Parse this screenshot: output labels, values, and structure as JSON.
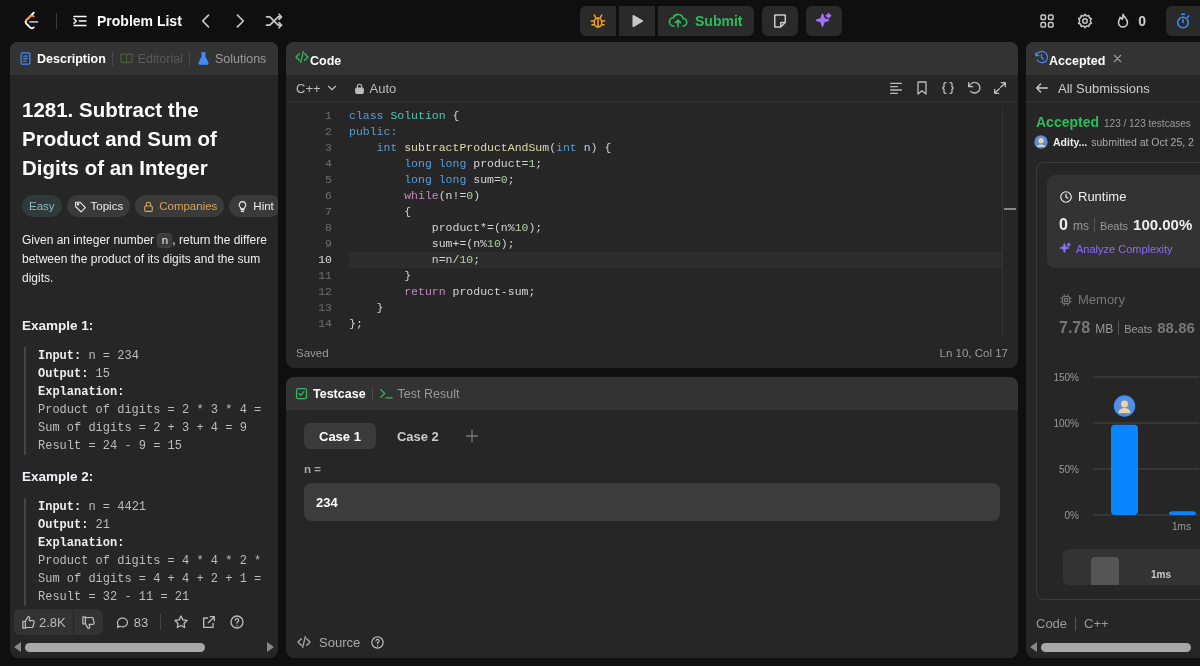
{
  "topbar": {
    "problem_list": "Problem List",
    "submit": "Submit",
    "streak": "0"
  },
  "description_panel": {
    "tabs": [
      {
        "label": "Description",
        "kind": "description",
        "selected": true,
        "disabled": false
      },
      {
        "label": "Editorial",
        "kind": "editorial",
        "selected": false,
        "disabled": true
      },
      {
        "label": "Solutions",
        "kind": "solutions",
        "selected": false,
        "disabled": false
      }
    ],
    "title": "1281. Subtract the Product and Sum of Digits of an Integer",
    "tags": [
      {
        "kind": "difficulty",
        "label": "Easy"
      },
      {
        "kind": "topics",
        "label": "Topics"
      },
      {
        "kind": "premium",
        "label": "Companies"
      },
      {
        "kind": "hint",
        "label": "Hint"
      }
    ],
    "description": [
      [
        {
          "text": "Given an integer number "
        },
        {
          "code": "n"
        },
        {
          "text": ", return the differe"
        }
      ],
      [
        {
          "text": "between the product of its digits and the sum"
        }
      ],
      [
        {
          "text": "digits."
        }
      ]
    ],
    "examples": [
      {
        "heading": "Example 1:",
        "lines": [
          {
            "label": "Input:",
            "value": "n = 234"
          },
          {
            "label": "Output:",
            "value": "15"
          },
          {
            "label": "Explanation:"
          },
          {
            "value": "Product of digits = 2 * 3 * 4 ="
          },
          {
            "value": "Sum of digits = 2 + 3 + 4 = 9"
          },
          {
            "value": "Result = 24 - 9 = 15"
          }
        ]
      },
      {
        "heading": "Example 2:",
        "lines": [
          {
            "label": "Input:",
            "value": "n = 4421"
          },
          {
            "label": "Output:",
            "value": "21"
          },
          {
            "label": "Explanation:"
          },
          {
            "value": "Product of digits = 4 * 4 * 2 *"
          },
          {
            "value": "Sum of digits = 4 + 4 + 2 + 1 ="
          },
          {
            "value": "Result = 32 - 11 = 21"
          }
        ]
      }
    ],
    "footer": {
      "likes": "2.8K",
      "comments": "83"
    }
  },
  "code_panel": {
    "title": "Code",
    "language": "C++",
    "mode": "Auto",
    "lines": [
      {
        "number": "1",
        "current": false,
        "tokens": [
          {
            "kind": "keyword",
            "text": "class"
          },
          {
            "kind": "type",
            "text": " Solution"
          },
          {
            "kind": "plain",
            "text": " {"
          }
        ]
      },
      {
        "number": "2",
        "current": false,
        "tokens": [
          {
            "kind": "keyword",
            "text": "public:"
          }
        ]
      },
      {
        "number": "3",
        "current": false,
        "tokens": [
          {
            "kind": "keyword",
            "text": "    int"
          },
          {
            "kind": "function",
            "text": " subtractProductAndSum"
          },
          {
            "kind": "plain",
            "text": "("
          },
          {
            "kind": "keyword",
            "text": "int"
          },
          {
            "kind": "variable",
            "text": " n"
          },
          {
            "kind": "plain",
            "text": ") {"
          }
        ]
      },
      {
        "number": "4",
        "current": false,
        "tokens": [
          {
            "kind": "keyword",
            "text": "        long long"
          },
          {
            "kind": "plain",
            "text": " product="
          },
          {
            "kind": "number",
            "text": "1"
          },
          {
            "kind": "plain",
            "text": ";"
          }
        ]
      },
      {
        "number": "5",
        "current": false,
        "tokens": [
          {
            "kind": "keyword",
            "text": "        long long"
          },
          {
            "kind": "plain",
            "text": " sum="
          },
          {
            "kind": "number",
            "text": "0"
          },
          {
            "kind": "plain",
            "text": ";"
          }
        ]
      },
      {
        "number": "6",
        "current": false,
        "tokens": [
          {
            "kind": "control",
            "text": "        while"
          },
          {
            "kind": "plain",
            "text": "(n!="
          },
          {
            "kind": "number",
            "text": "0"
          },
          {
            "kind": "plain",
            "text": ")"
          }
        ]
      },
      {
        "number": "7",
        "current": false,
        "tokens": [
          {
            "kind": "plain",
            "text": "        {"
          }
        ]
      },
      {
        "number": "8",
        "current": false,
        "tokens": [
          {
            "kind": "plain",
            "text": "            product*=(n%"
          },
          {
            "kind": "number",
            "text": "10"
          },
          {
            "kind": "plain",
            "text": ");"
          }
        ]
      },
      {
        "number": "9",
        "current": false,
        "tokens": [
          {
            "kind": "plain",
            "text": "            sum+=(n%"
          },
          {
            "kind": "number",
            "text": "10"
          },
          {
            "kind": "plain",
            "text": ");"
          }
        ]
      },
      {
        "number": "10",
        "current": true,
        "tokens": [
          {
            "kind": "plain",
            "text": "            n=n/"
          },
          {
            "kind": "number",
            "text": "10"
          },
          {
            "kind": "plain",
            "text": ";"
          }
        ]
      },
      {
        "number": "11",
        "current": false,
        "tokens": [
          {
            "kind": "plain",
            "text": "        }"
          }
        ]
      },
      {
        "number": "12",
        "current": false,
        "tokens": [
          {
            "kind": "control",
            "text": "        return"
          },
          {
            "kind": "plain",
            "text": " product-sum;"
          }
        ]
      },
      {
        "number": "13",
        "current": false,
        "tokens": [
          {
            "kind": "plain",
            "text": "    }"
          }
        ]
      },
      {
        "number": "14",
        "current": false,
        "tokens": [
          {
            "kind": "plain",
            "text": "};"
          }
        ]
      }
    ],
    "status": "Saved",
    "cursor": "Ln 10, Col 17"
  },
  "testcase_panel": {
    "tabs": [
      {
        "label": "Testcase",
        "kind": "testcase",
        "selected": true
      },
      {
        "label": "Test Result",
        "kind": "result",
        "selected": false
      }
    ],
    "cases": [
      {
        "label": "Case 1",
        "selected": true
      },
      {
        "label": "Case 2",
        "selected": false
      }
    ],
    "param": "n =",
    "value": "234",
    "source": "Source"
  },
  "submission_panel": {
    "tab": "Accepted",
    "back": "All Submissions",
    "verdict": "Accepted",
    "testcases": "123 / 123 testcases",
    "user": "Adity...",
    "submitted": "submitted at Oct 25, 2",
    "metrics": [
      {
        "kind": "runtime",
        "selected": true,
        "label": "Runtime",
        "value": "0",
        "unit": "ms",
        "beats_label": "Beats",
        "beats": "100.00%",
        "action": "Analyze Complexity"
      },
      {
        "kind": "memory",
        "selected": false,
        "label": "Memory",
        "value": "7.78",
        "unit": "MB",
        "beats_label": "Beats",
        "beats": "88.86"
      }
    ],
    "chart_data": {
      "type": "bar",
      "categories": [
        null,
        "1ms"
      ],
      "values": [
        98,
        4
      ],
      "ylim": [
        0,
        150
      ],
      "yticks": [
        {
          "value": 0,
          "label": "0%"
        },
        {
          "value": 50,
          "label": "50%"
        },
        {
          "value": 100,
          "label": "100%"
        },
        {
          "value": 150,
          "label": "150%"
        }
      ]
    },
    "navigator_label": "1ms",
    "code_label": "Code",
    "code_language": "C++"
  }
}
